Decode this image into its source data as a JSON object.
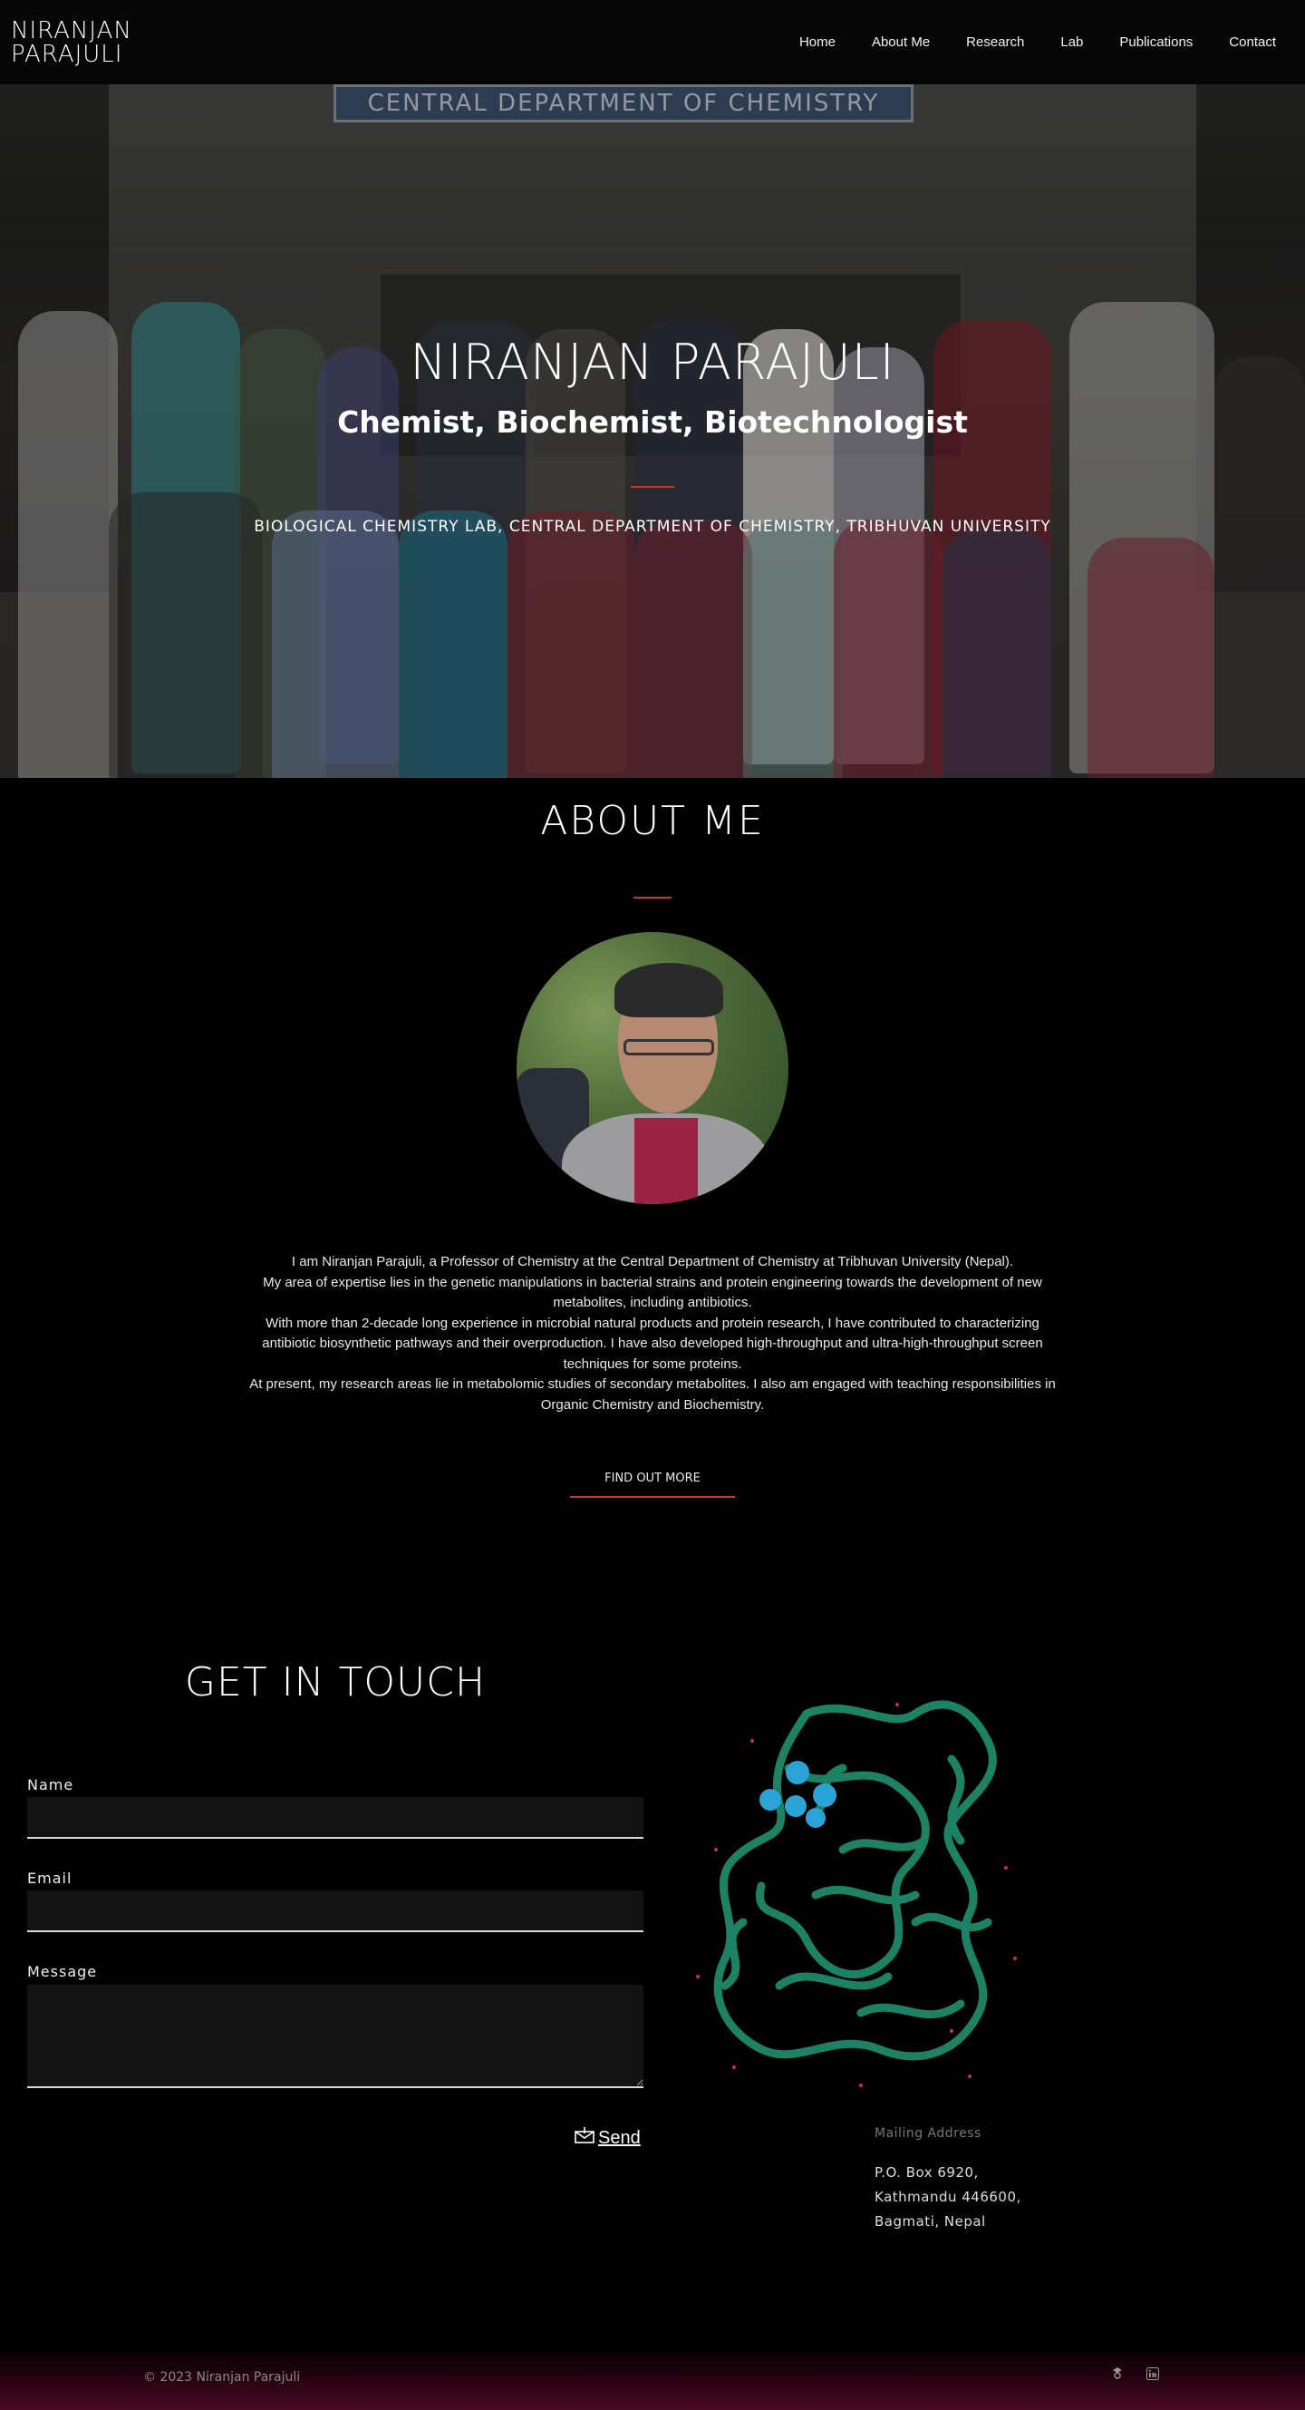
{
  "nav": {
    "brand_line1": "NIRANJAN",
    "brand_line2": "PARAJULI",
    "items": [
      "Home",
      "About Me",
      "Research",
      "Lab",
      "Publications",
      "Contact"
    ]
  },
  "hero": {
    "sign_text": "CENTRAL DEPARTMENT OF CHEMISTRY",
    "title": "NIRANJAN PARAJULI",
    "subtitle": "Chemist, Biochemist, Biotechnologist",
    "lab": "BIOLOGICAL CHEMISTRY LAB, CENTRAL DEPARTMENT OF CHEMISTRY, TRIBHUVAN UNIVERSITY"
  },
  "about": {
    "title": "ABOUT ME",
    "paragraphs": [
      "I am Niranjan Parajuli, a Professor of Chemistry at the Central Department of Chemistry at Tribhuvan University (Nepal).",
      "My area of expertise lies in the genetic manipulations in bacterial strains and protein engineering towards the development of new metabolites, including antibiotics.",
      "With more than 2-decade long experience in microbial natural products and protein research, I have contributed to characterizing antibiotic biosynthetic pathways and their overproduction. I have also developed high-throughput and ultra-high-throughput screen techniques for some proteins.",
      "At present, my research areas lie in metabolomic studies of secondary metabolites. I also am engaged with teaching responsibilities in Organic Chemistry and Biochemistry."
    ],
    "button": "FIND OUT MORE"
  },
  "contact": {
    "title": "GET IN TOUCH",
    "name_label": "Name",
    "email_label": "Email",
    "message_label": "Message",
    "send_label": "Send",
    "mailing_head": "Mailing Address",
    "address": [
      "P.O. Box 6920,",
      "Kathmandu 446600,",
      "Bagmati, Nepal"
    ]
  },
  "footer": {
    "copyright": "© 2023 Niranjan Parajuli",
    "icons": [
      "google-scholar-icon",
      "linkedin-icon"
    ]
  },
  "colors": {
    "accent": "#c0392b",
    "protein": "#1f8a6a",
    "ligand": "#2aa3d6",
    "footer_gradient_end": "#4a0a22"
  }
}
